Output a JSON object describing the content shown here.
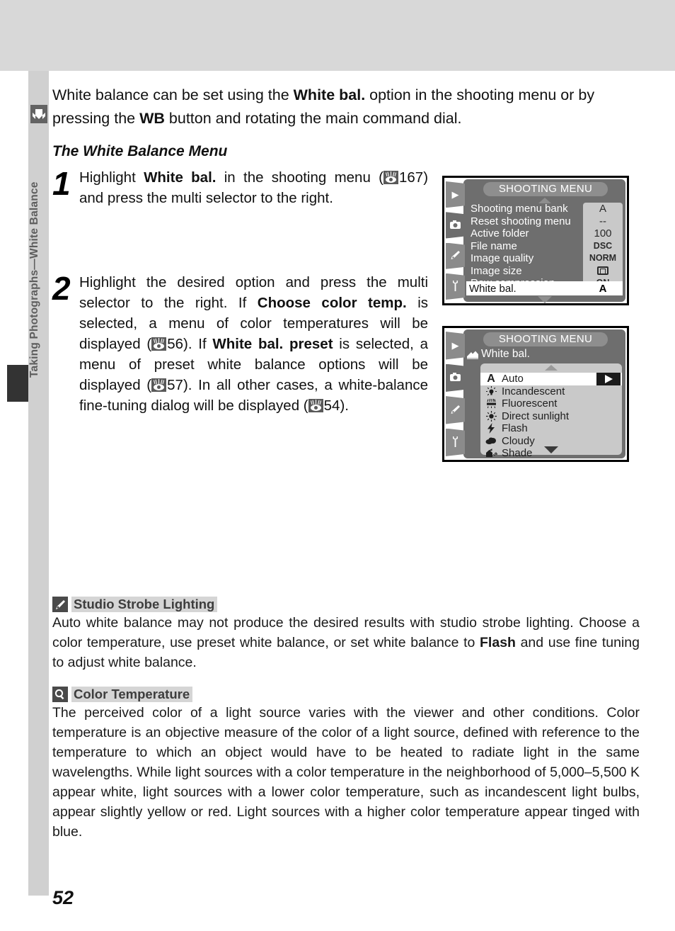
{
  "chapter": {
    "side_title": "Taking Photographs—White Balance",
    "side_icon": "camera-icon"
  },
  "page": {
    "number": "52"
  },
  "intro": {
    "part1": "White balance can be set using the ",
    "bold1": "White bal.",
    "part2": " option in the shooting menu or by pressing the ",
    "bold2": "WB",
    "part3": " button and rotating the main command dial."
  },
  "section": {
    "heading": "The White Balance Menu"
  },
  "steps": [
    {
      "number": "1",
      "t1": "Highlight ",
      "b1": "White bal.",
      "t2": " in the shooting menu (",
      "ref1": "167",
      "t3": ") and press the multi selector to the right."
    },
    {
      "number": "2",
      "t1": "Highlight the desired option and press the multi selector to the right.  If ",
      "b1": "Choose color temp.",
      "t2": " is selected, a menu of color temperatures will be displayed (",
      "ref1": "56",
      "t3": ").  If ",
      "b2": "White bal. preset",
      "t4": " is selected, a menu of preset white balance options will be displayed (",
      "ref2": "57",
      "t5": ").  In all other cases, a white-balance fine-tuning dialog will be displayed (",
      "ref3": "54",
      "t6": ")."
    }
  ],
  "menu1": {
    "title": "SHOOTING MENU",
    "tabs": [
      "playback-icon",
      "camera-icon",
      "pencil-icon",
      "wrench-icon"
    ],
    "rows": [
      {
        "label": "Shooting menu bank",
        "value": "A",
        "style": "normal"
      },
      {
        "label": "Reset shooting menu",
        "value": "--",
        "style": "normal"
      },
      {
        "label": "Active folder",
        "value": "100",
        "style": "normal"
      },
      {
        "label": "File name",
        "value": "DSC",
        "style": "small"
      },
      {
        "label": "Image quality",
        "value": "NORM",
        "style": "small"
      },
      {
        "label": "Image size",
        "value": "",
        "style": "glyph"
      },
      {
        "label": "Raw compression",
        "value": "ON",
        "style": "small"
      }
    ],
    "highlighted": {
      "label": "White bal.",
      "value": "A"
    }
  },
  "menu2": {
    "title": "SHOOTING MENU",
    "breadcrumb": "White bal.",
    "breadcrumb_icon": "white-balance-icon",
    "tabs": [
      "playback-icon",
      "camera-icon",
      "pencil-icon",
      "wrench-icon"
    ],
    "options": [
      {
        "icon": "A",
        "label": "Auto",
        "selected": true
      },
      {
        "icon": "incandescent-icon",
        "label": "Incandescent",
        "selected": false
      },
      {
        "icon": "fluorescent-icon",
        "label": "Fluorescent",
        "selected": false
      },
      {
        "icon": "sun-icon",
        "label": "Direct sunlight",
        "selected": false
      },
      {
        "icon": "flash-icon",
        "label": "Flash",
        "selected": false
      },
      {
        "icon": "cloud-icon",
        "label": "Cloudy",
        "selected": false
      },
      {
        "icon": "shade-icon",
        "label": "Shade",
        "selected": false
      }
    ]
  },
  "notes": [
    {
      "icon": "pencil-icon",
      "title": "Studio Strobe Lighting",
      "t1": "Auto white balance may not produce the desired results with studio strobe lighting.  Choose a color temperature, use preset white balance, or set white balance to ",
      "b1": "Flash",
      "t2": " and use fine tuning to adjust white balance."
    },
    {
      "icon": "magnifier-icon",
      "title": "Color Temperature",
      "t1": "The perceived color of a light source varies with the viewer and other conditions.  Color temperature is an objective measure of the color of a light source, defined with reference to the temperature to which an object would have to be heated to radiate light in the same wavelengths.  While light sources with a color temperature in the neighborhood of 5,000–5,500 K appear white, light sources with a lower color temperature, such as incandescent light bulbs, appear slightly yellow or red.  Light sources with a higher color temperature appear tinged with blue."
    }
  ]
}
